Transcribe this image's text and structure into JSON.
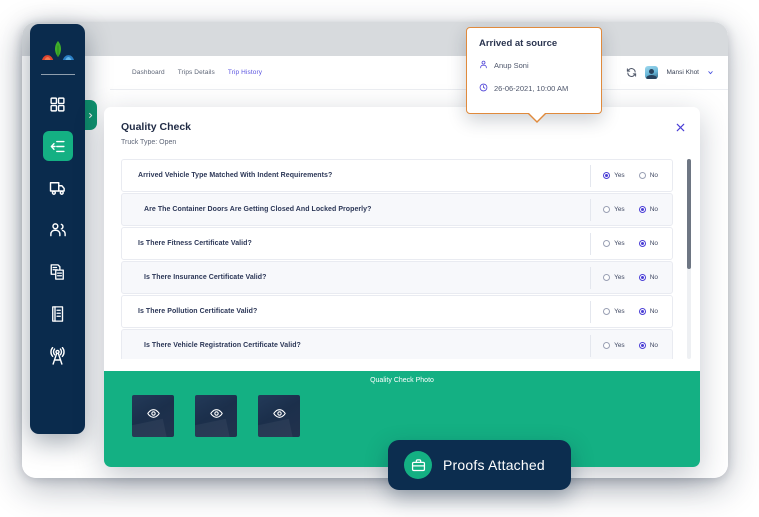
{
  "window": {
    "topbar_aria": "browser-chrome"
  },
  "sidebar": {
    "logo_name": "app-logo",
    "items": [
      {
        "id": "dashboard",
        "icon": "grid-icon",
        "active": false
      },
      {
        "id": "trips",
        "icon": "trips-list-icon",
        "active": true
      },
      {
        "id": "vehicles",
        "icon": "truck-icon",
        "active": false
      },
      {
        "id": "users",
        "icon": "users-icon",
        "active": false
      },
      {
        "id": "documents",
        "icon": "documents-icon",
        "active": false
      },
      {
        "id": "reports",
        "icon": "report-icon",
        "active": false
      },
      {
        "id": "tracking",
        "icon": "broadcast-tower-icon",
        "active": false
      }
    ],
    "collapse_toggle": "collapse-sidebar-toggle"
  },
  "header": {
    "breadcrumb": [
      {
        "label": "Dashboard",
        "active": false
      },
      {
        "label": "Trips Details",
        "active": false
      },
      {
        "label": "Trip History",
        "active": true
      }
    ],
    "refresh_icon": "refresh-icon",
    "user_name": "Mansi Khot",
    "chevron_icon": "chevron-down-icon"
  },
  "modal": {
    "title": "Quality Check",
    "subtitle": "Truck Type: Open",
    "close_icon": "close-icon",
    "options": {
      "yes": "Yes",
      "no": "No"
    },
    "questions": [
      {
        "text": "Arrived Vehicle Type Matched With Indent Requirements?",
        "answer": "Yes"
      },
      {
        "text": "Are The Container Doors Are Getting Closed And Locked Properly?",
        "answer": "No"
      },
      {
        "text": "Is There Fitness Certificate Valid?",
        "answer": "No"
      },
      {
        "text": "Is There Insurance Certificate Valid?",
        "answer": "No"
      },
      {
        "text": "Is There Pollution Certificate Valid?",
        "answer": "No"
      },
      {
        "text": "Is There Vehicle Registration Certificate Valid?",
        "answer": "No"
      }
    ],
    "photo_section": {
      "title": "Quality Check Photo",
      "thumbnails": [
        {
          "id": "photo-1",
          "overlay_icon": "eye-icon"
        },
        {
          "id": "photo-2",
          "overlay_icon": "eye-icon"
        },
        {
          "id": "photo-3",
          "overlay_icon": "eye-icon"
        }
      ]
    }
  },
  "tooltip": {
    "title": "Arrived at source",
    "person_icon": "person-icon",
    "person": "Anup Soni",
    "clock_icon": "clock-icon",
    "datetime": "26-06-2021, 10:00 AM"
  },
  "proofs_badge": {
    "icon": "briefcase-icon",
    "label": "Proofs Attached"
  },
  "colors": {
    "sidebar_navy": "#0a2b4d",
    "accent_green": "#14b083",
    "radio_indigo": "#4b3fd6",
    "breadcrumb_active": "#5b55e0",
    "tooltip_border": "#e08a3c",
    "badge_navy": "#0c2d4f"
  }
}
